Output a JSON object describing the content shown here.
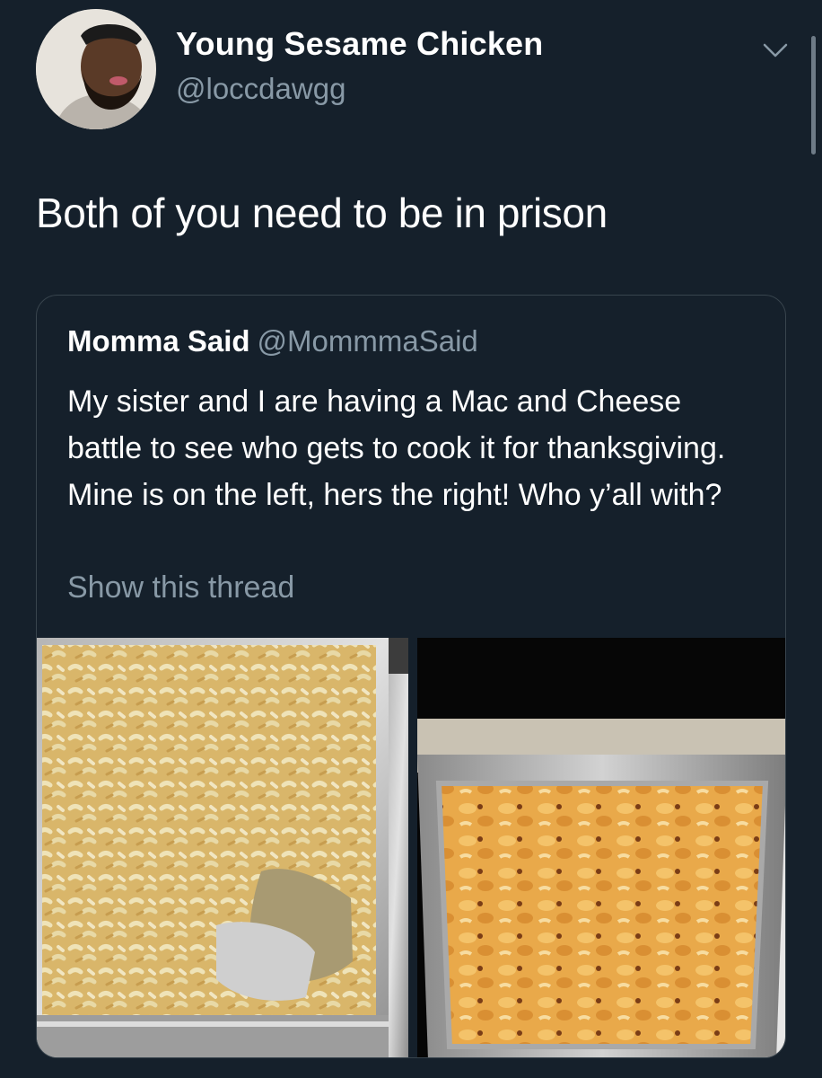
{
  "tweet": {
    "author": {
      "display_name": "Young Sesame Chicken",
      "handle": "@loccdawgg"
    },
    "text": "Both of you need to be in prison",
    "menu_icon": "chevron-down-icon"
  },
  "quoted_tweet": {
    "author": {
      "display_name": "Momma Said",
      "handle": "@MommmaSaid"
    },
    "text": "My sister and I are having a Mac and Cheese battle to see who gets to cook it for thanksgiving. Mine is on the left, hers the right! Who y’all with?",
    "show_thread_label": "Show this thread"
  },
  "colors": {
    "background": "#15202b",
    "secondary_text": "#8899a6",
    "border": "#38444d"
  }
}
